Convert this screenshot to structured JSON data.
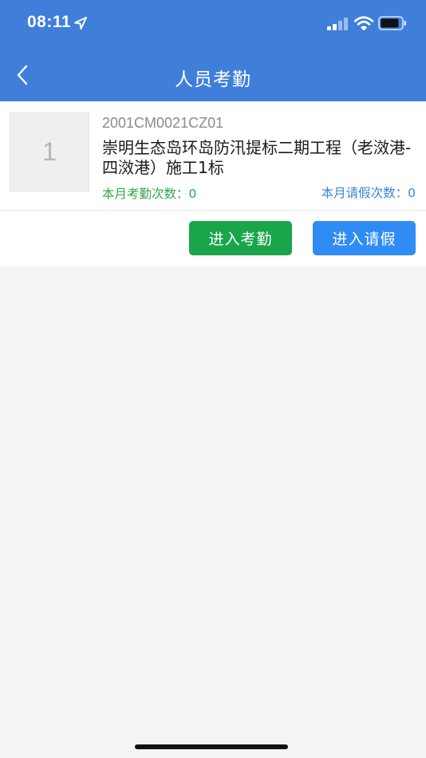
{
  "status_bar": {
    "time": "08:11",
    "icons": [
      "location-arrow-icon",
      "cellular-signal-icon",
      "wifi-icon",
      "battery-icon"
    ]
  },
  "nav": {
    "title": "人员考勤",
    "back_icon": "chevron-left-icon"
  },
  "card": {
    "thumbnail_label": "1",
    "code": "2001CM0021CZ01",
    "project_name": "崇明生态岛环岛防汛提标二期工程（老滧港-四滧港）施工1标",
    "attendance_count": "本月考勤次数：0",
    "leave_count": "本月请假次数：0",
    "attendance_button": "进入考勤",
    "leave_button": "进入请假"
  },
  "colors": {
    "header_bg": "#3f7fda",
    "page_bg": "#f4f4f4",
    "attendance_green": "#1aa54a",
    "leave_blue": "#2f8cf5",
    "count_green": "#2fa84a",
    "count_blue": "#3b86d6"
  }
}
